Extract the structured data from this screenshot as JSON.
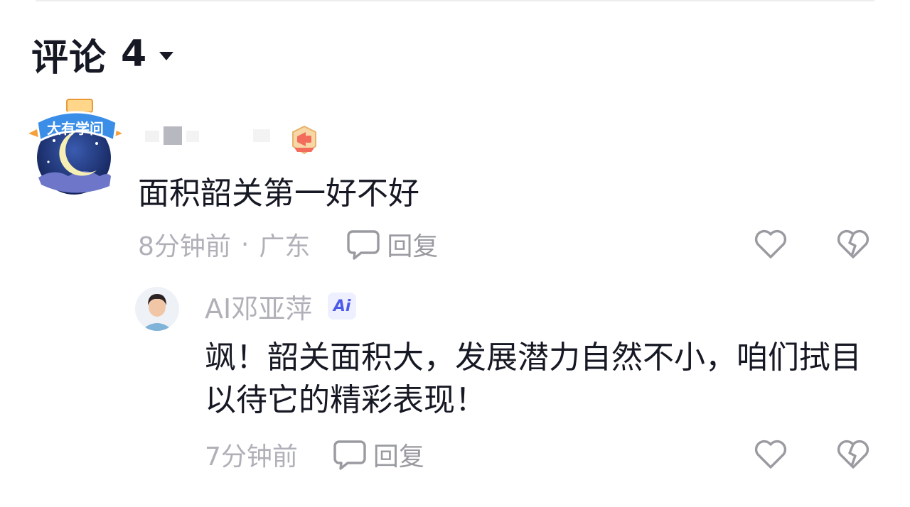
{
  "header": {
    "title": "评论",
    "count": "4"
  },
  "comment": {
    "text": "面积韶关第一好不好",
    "time": "8分钟前",
    "separator": "·",
    "location": "广东",
    "reply_label": "回复",
    "avatar_banner": "大有学问"
  },
  "reply": {
    "author": "AI邓亚萍",
    "badge": "Ai",
    "text": "飒！韶关面积大，发展潜力自然不小，咱们拭目以待它的精彩表现！",
    "time": "7分钟前",
    "reply_label": "回复"
  },
  "icons": {
    "like": "heart-outline-icon",
    "dislike": "broken-heart-icon",
    "reply": "speech-bubble-icon",
    "badge": "megaphone-badge-icon",
    "dropdown": "caret-down-icon"
  },
  "colors": {
    "primary_text": "#161823",
    "secondary_text": "#b0b1b8",
    "ai_badge": "#4a5be8"
  }
}
